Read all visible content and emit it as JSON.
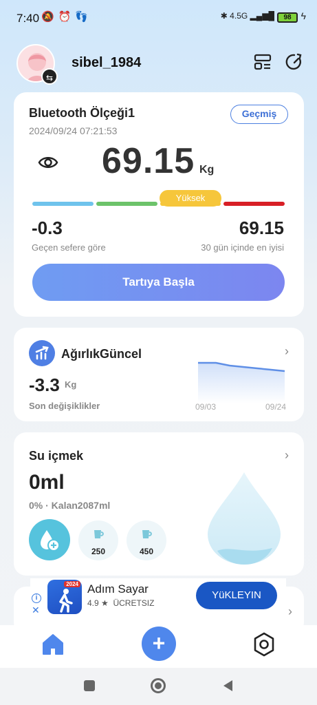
{
  "status_bar": {
    "time": "7:40",
    "left_icons": "🔕⏰👣",
    "right_icons": "✱ 4.5G ▂▄▆█",
    "battery": "98"
  },
  "header": {
    "username": "sibel_1984",
    "icons": [
      "swap-icon",
      "device-icon",
      "refresh-icon"
    ]
  },
  "scale_card": {
    "name": "Bluetooth Ölçeği1",
    "history_button": "Geçmiş",
    "datetime": "2024/09/24 07:21:53",
    "weight": "69.15",
    "unit": "Kg",
    "status": "Yüksek",
    "range_colors": [
      "#6fc3ec",
      "#6cc36a",
      "#f6c63b",
      "#d81f26"
    ],
    "change_value": "-0.3",
    "change_label": "Geçen sefere göre",
    "best_value": "69.15",
    "best_label": "30 gün içinde en iyisi",
    "start_button": "Tartıya Başla"
  },
  "trend_card": {
    "title": "AğırlıkGüncel",
    "value": "-3.3",
    "unit": "Kg",
    "label": "Son değişiklikler",
    "date_start": "09/03",
    "date_end": "09/24"
  },
  "water_card": {
    "title": "Su içmek",
    "amount": "0ml",
    "progress_text": "0% · Kalan2087ml",
    "progress": 0,
    "cups": [
      "250",
      "450"
    ]
  },
  "ad": {
    "app_name": "Adım Sayar",
    "rating": "4.9 ★",
    "price": "ÜCRETSIZ",
    "install_button": "YüKLEYIN",
    "logo_badge": "2024"
  },
  "bottom_nav": {
    "items": [
      "home-icon",
      "add-icon",
      "settings-icon"
    ],
    "fab_symbol": "+"
  },
  "colors": {
    "accent": "#4f87ec",
    "high": "#f6c63b",
    "water": "#56c3dd"
  }
}
